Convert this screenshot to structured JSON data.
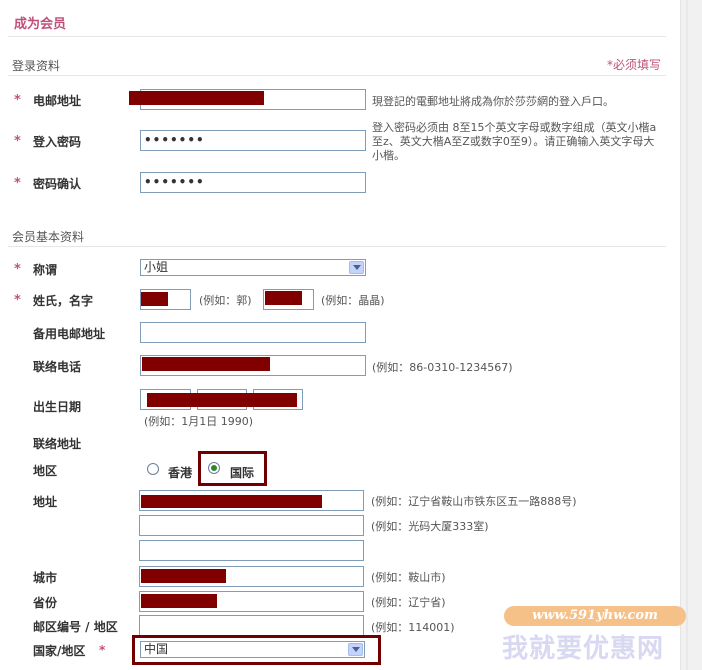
{
  "page": {
    "title": "成为会员"
  },
  "login_section": {
    "title": "登录资料",
    "required_note": "*必须填写",
    "email": {
      "label": "电邮地址",
      "hint": "現登記的電郵地址將成為你於莎莎網的登入戶口。"
    },
    "password": {
      "label": "登入密码",
      "value": "•••••••",
      "hint": "登入密码必须由 8至15个英文字母或数字组成（英文小楷a至z、英文大楷A至Z或数字0至9）。请正确输入英文字母大小楷。"
    },
    "confirm": {
      "label": "密码确认",
      "value": "•••••••"
    }
  },
  "basic_section": {
    "title": "会员基本资料",
    "salutation": {
      "label": "称谓",
      "value": "小姐"
    },
    "name": {
      "label": "姓氏，名字",
      "surname_hint": "(例如：郭)",
      "given_hint": "(例如：晶晶)"
    },
    "alt_email": {
      "label": "备用电邮地址"
    },
    "phone": {
      "label": "联络电话",
      "hint": "(例如：86-0310-1234567)"
    },
    "birthday": {
      "label": "出生日期",
      "hint": "(例如：1月1日 1990)"
    },
    "contact_address": {
      "label": "联络地址"
    },
    "region": {
      "label": "地区",
      "option_hk": "香港",
      "option_intl": "国际",
      "selected": "国际"
    },
    "address": {
      "label": "地址",
      "hint1": "(例如：辽宁省鞍山市铁东区五一路888号)",
      "hint2": "(例如：光码大厦333室)"
    },
    "city": {
      "label": "城市",
      "hint": "(例如：鞍山市)"
    },
    "province": {
      "label": "省份",
      "hint": "(例如：辽宁省)"
    },
    "postal": {
      "label": "邮区编号 / 地区",
      "hint": "(例如：114001)"
    },
    "country": {
      "label": "国家/地区",
      "required_mark": "*",
      "value": "中国"
    }
  },
  "watermark": {
    "url": "www.591yhw.com",
    "text": "我就要优惠网"
  },
  "colors": {
    "accent": "#c0507a",
    "redaction": "#800000",
    "highlight": "#700000"
  }
}
